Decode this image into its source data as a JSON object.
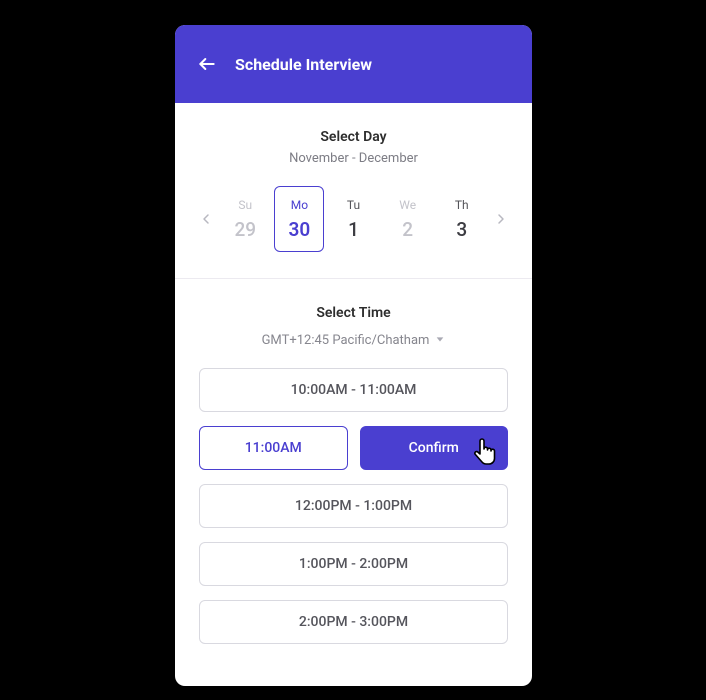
{
  "header": {
    "title": "Schedule Interview"
  },
  "day_section": {
    "title": "Select Day",
    "range": "November - December",
    "days": [
      {
        "dow": "Su",
        "num": "29",
        "state": "disabled"
      },
      {
        "dow": "Mo",
        "num": "30",
        "state": "selected"
      },
      {
        "dow": "Tu",
        "num": "1",
        "state": "normal"
      },
      {
        "dow": "We",
        "num": "2",
        "state": "disabled"
      },
      {
        "dow": "Th",
        "num": "3",
        "state": "normal"
      }
    ]
  },
  "time_section": {
    "title": "Select Time",
    "timezone": "GMT+12:45 Pacific/Chatham",
    "slots": [
      "10:00AM - 11:00AM",
      "12:00PM - 1:00PM",
      "1:00PM - 2:00PM",
      "2:00PM - 3:00PM"
    ],
    "selected_short": "11:00AM",
    "confirm_label": "Confirm"
  }
}
